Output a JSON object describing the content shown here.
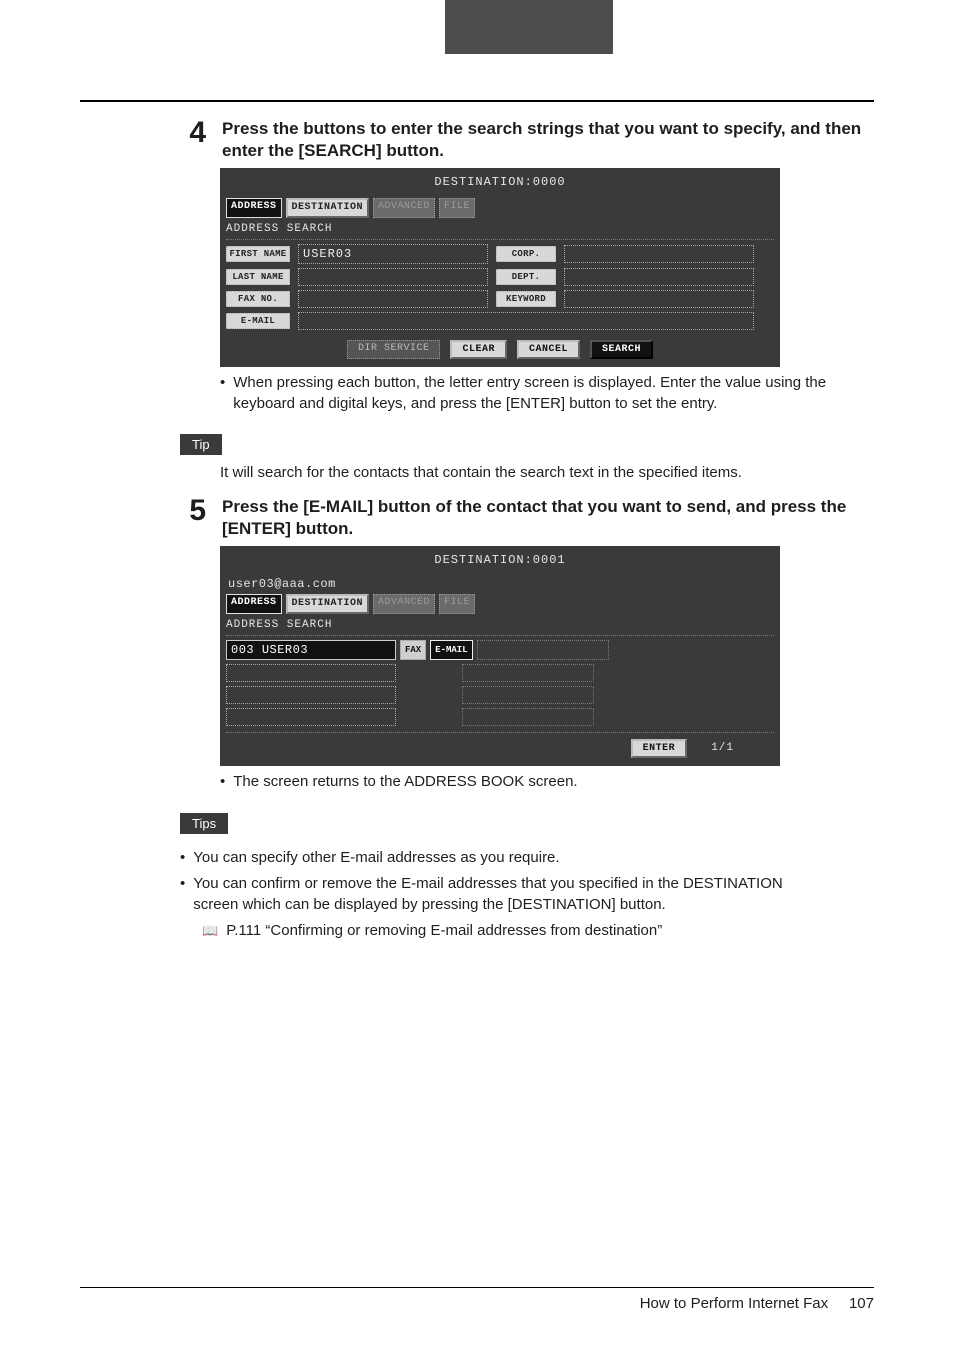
{
  "step4": {
    "num": "4",
    "text": "Press the buttons to enter the search strings that you want to specify, and then enter the [SEARCH] button."
  },
  "lcd1": {
    "title": "DESTINATION:0000",
    "tabs": {
      "address": "ADDRESS",
      "destination": "DESTINATION",
      "advanced": "ADVANCED",
      "file": "FILE"
    },
    "section": "ADDRESS SEARCH",
    "labels": {
      "first": "FIRST NAME",
      "last": "LAST NAME",
      "fax": "FAX NO.",
      "email": "E-MAIL",
      "corp": "CORP.",
      "dept": "DEPT.",
      "keyword": "KEYWORD"
    },
    "values": {
      "first": "USER03",
      "last": "",
      "fax": "",
      "email": "",
      "corp": "",
      "dept": "",
      "keyword": ""
    },
    "buttons": {
      "dir": "DIR SERVICE",
      "clear": "CLEAR",
      "cancel": "CANCEL",
      "search": "SEARCH"
    }
  },
  "note1": "When pressing each button, the letter entry screen is displayed.  Enter the value using the keyboard and digital keys, and press the [ENTER] button to set the entry.",
  "tip_label": "Tip",
  "tip_text": "It will search for the contacts that contain the search text in the specified items.",
  "step5": {
    "num": "5",
    "text": "Press the [E-MAIL] button of the contact that you want to send, and press the [ENTER] button."
  },
  "lcd2": {
    "title": "DESTINATION:0001",
    "selected": "user03@aaa.com",
    "tabs": {
      "address": "ADDRESS",
      "destination": "DESTINATION",
      "advanced": "ADVANCED",
      "file": "FILE"
    },
    "section": "ADDRESS SEARCH",
    "row1_id": "003",
    "row1_name": "USER03",
    "fax_btn": "FAX",
    "email_btn": "E-MAIL",
    "enter_btn": "ENTER",
    "page_indicator": "1/1"
  },
  "note2": "The screen returns to the ADDRESS BOOK screen.",
  "tips_label": "Tips",
  "tips": [
    "You can specify other E-mail addresses as you require.",
    "You can confirm or remove the E-mail addresses that you specified in the DESTINATION screen which can be displayed by pressing the [DESTINATION] button."
  ],
  "ref": "P.111 “Confirming or removing E-mail addresses from destination”",
  "footer": {
    "title": "How to Perform Internet Fax",
    "page": "107"
  }
}
